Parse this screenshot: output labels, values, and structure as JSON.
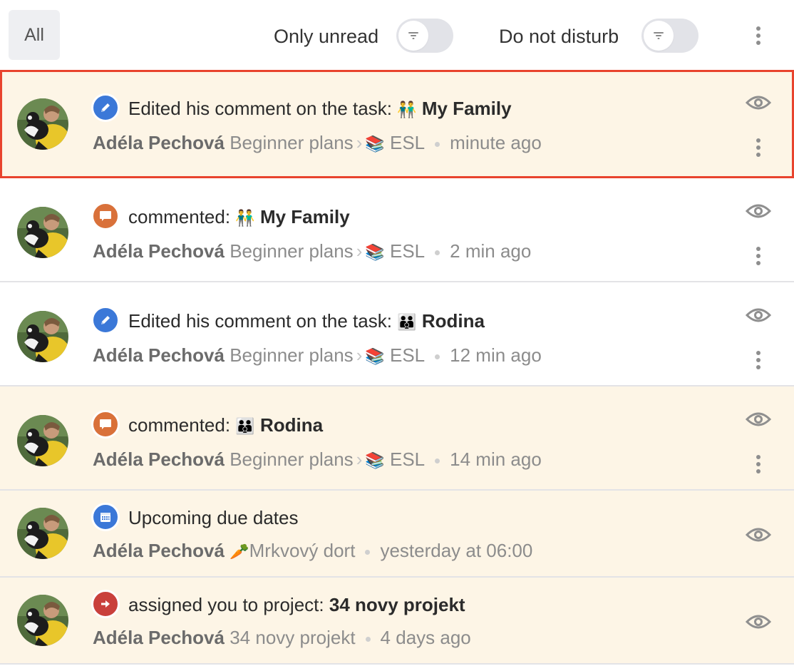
{
  "toolbar": {
    "all_label": "All",
    "only_unread_label": "Only unread",
    "only_unread_on": false,
    "do_not_disturb_label": "Do not disturb",
    "do_not_disturb_on": false,
    "toggle_icon": "filter-icon",
    "menu_icon": "more-vertical-icon"
  },
  "colors": {
    "unread_bg": "#fdf5e6",
    "selected_border": "#e8432d",
    "edit_icon": "#3b78d8",
    "comment_icon": "#d9713a",
    "calendar_icon": "#3b78d8",
    "assign_icon": "#c9403c"
  },
  "notifications": [
    {
      "state": "unread-selected",
      "icon": "pencil-icon",
      "action": "Edited his comment on the task:",
      "emoji": "👬",
      "target": "My Family",
      "author": "Adéla Pechová",
      "project": "Beginner plans",
      "section_emoji": "📚",
      "section": "ESL",
      "time": "minute ago",
      "has_menu": true
    },
    {
      "state": "read",
      "icon": "comment-icon",
      "action": "commented:",
      "emoji": "👬",
      "target": "My Family",
      "author": "Adéla Pechová",
      "project": "Beginner plans",
      "section_emoji": "📚",
      "section": "ESL",
      "time": "2 min ago",
      "has_menu": true
    },
    {
      "state": "read",
      "icon": "pencil-icon",
      "action": "Edited his comment on the task:",
      "emoji": "👪",
      "target": "Rodina",
      "author": "Adéla Pechová",
      "project": "Beginner plans",
      "section_emoji": "📚",
      "section": "ESL",
      "time": "12 min ago",
      "has_menu": true
    },
    {
      "state": "unread",
      "icon": "comment-icon",
      "action": "commented:",
      "emoji": "👪",
      "target": "Rodina",
      "author": "Adéla Pechová",
      "project": "Beginner plans",
      "section_emoji": "📚",
      "section": "ESL",
      "time": "14 min ago",
      "has_menu": true
    },
    {
      "state": "unread",
      "icon": "calendar-icon",
      "action": "Upcoming due dates",
      "author": "Adéla Pechová",
      "project_emoji": "🥕",
      "project": "Mrkvový dort",
      "time": "yesterday at 06:00",
      "has_menu": false
    },
    {
      "state": "unread",
      "icon": "arrow-right-icon",
      "action": "assigned you to project:",
      "target": "34 novy projekt",
      "author": "Adéla Pechová",
      "project": "34 novy projekt",
      "time": "4 days ago",
      "has_menu": false
    }
  ]
}
